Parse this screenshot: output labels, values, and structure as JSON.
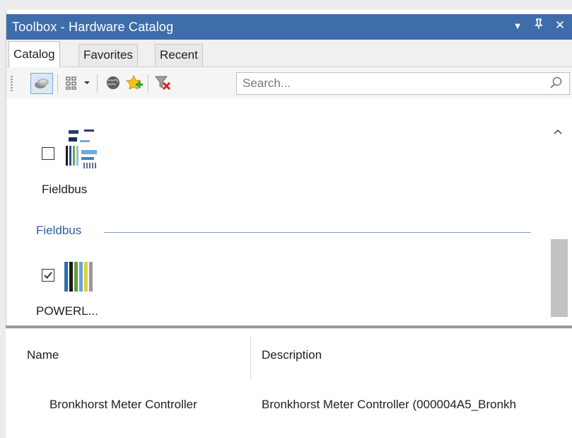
{
  "window": {
    "title": "Toolbox - Hardware Catalog",
    "controls": {
      "dropdown": "▼",
      "pin": "p",
      "close": "✕"
    }
  },
  "tabs": [
    {
      "label": "Catalog",
      "active": true
    },
    {
      "label": "Favorites",
      "active": false
    },
    {
      "label": "Recent",
      "active": false
    }
  ],
  "toolbar": {
    "search_placeholder": "Search...",
    "buttons": [
      "group-view-icon",
      "column-view-icon",
      "dropdown-arrow-icon",
      "globe-icon",
      "add-favorite-icon",
      "clear-filter-icon"
    ]
  },
  "catalog": {
    "items": [
      {
        "label": "Fieldbus",
        "checked": false,
        "icon": "fieldbus-cluster-icon"
      },
      {
        "label": "POWERL...",
        "checked": true,
        "icon": "powerlink-bars-icon"
      }
    ],
    "group": {
      "title": "Fieldbus"
    }
  },
  "details": {
    "columns": [
      "Name",
      "Description"
    ],
    "rows": [
      {
        "name": "Bronkhorst Meter Controller",
        "description": "Bronkhorst Meter Controller (000004A5_Bronkh"
      }
    ]
  },
  "colors": {
    "title_bar": "#3d6dab",
    "group_header": "#2c5ea3",
    "scroll_thumb": "#c2c2c2"
  }
}
